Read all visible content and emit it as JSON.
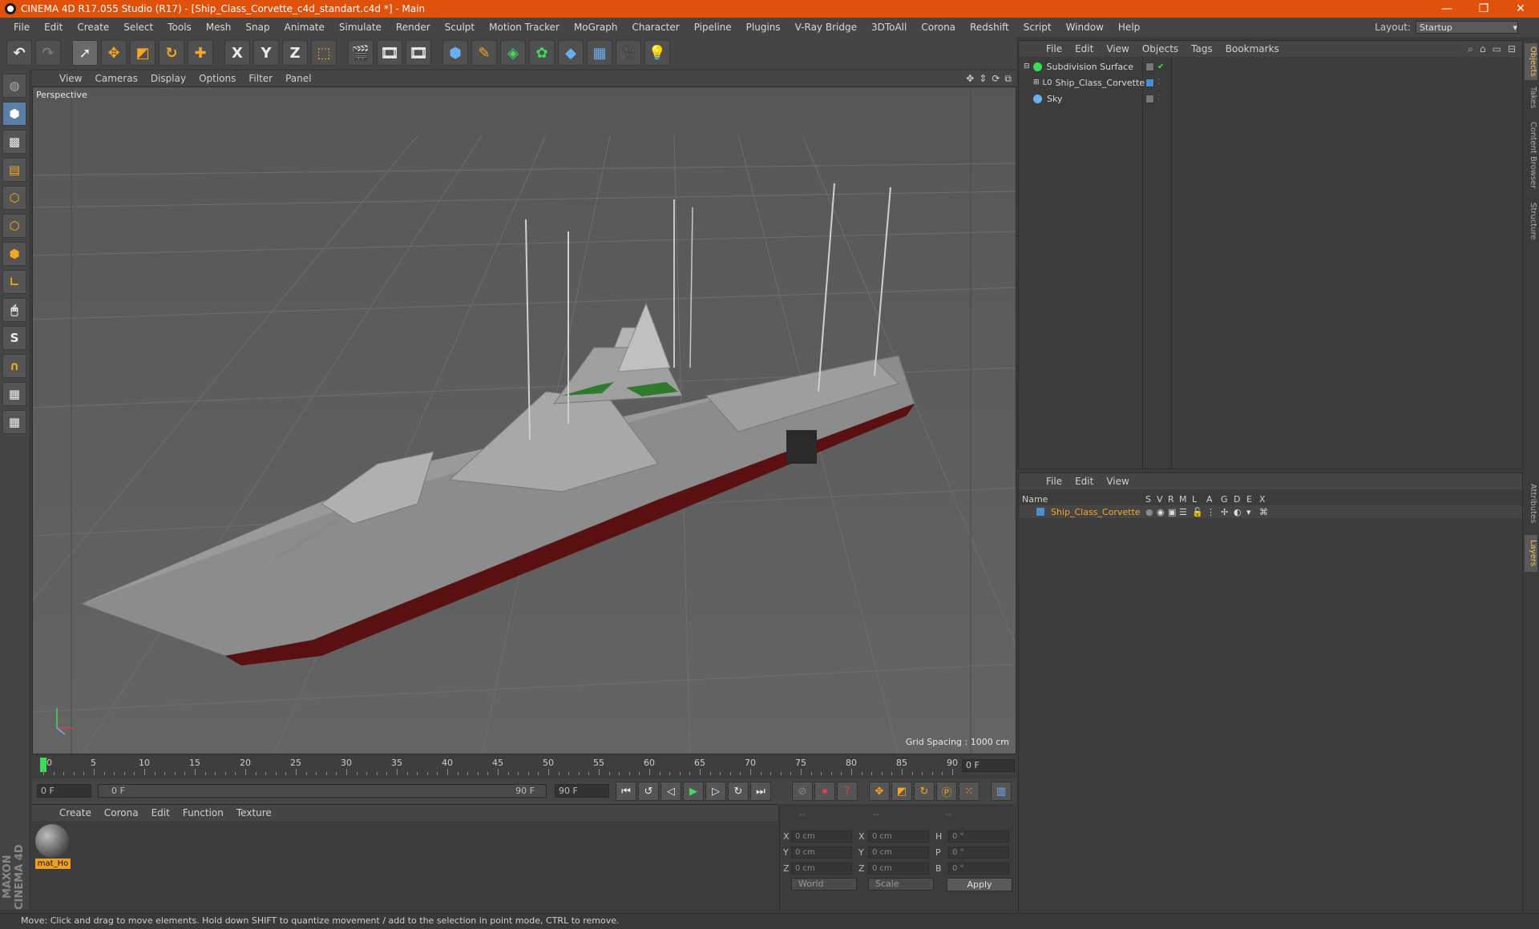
{
  "window": {
    "title": "CINEMA 4D R17.055 Studio (R17) - [Ship_Class_Corvette_c4d_standart.c4d *] - Main",
    "controls": [
      "—",
      "❐",
      "✕"
    ]
  },
  "menubar": {
    "items": [
      "File",
      "Edit",
      "Create",
      "Select",
      "Tools",
      "Mesh",
      "Snap",
      "Animate",
      "Simulate",
      "Render",
      "Sculpt",
      "Motion Tracker",
      "MoGraph",
      "Character",
      "Pipeline",
      "Plugins",
      "V-Ray Bridge",
      "3DToAll",
      "Corona",
      "Redshift",
      "Script",
      "Window",
      "Help"
    ],
    "layout_label": "Layout:",
    "layout_value": "Startup"
  },
  "toolbar": {
    "axis_x": "X",
    "axis_y": "Y",
    "axis_z": "Z"
  },
  "left_tools": {
    "snap_label": "S"
  },
  "maxon_logo": "MAXON CINEMA 4D",
  "viewport": {
    "menu": [
      "View",
      "Cameras",
      "Display",
      "Options",
      "Filter",
      "Panel"
    ],
    "label": "Perspective",
    "grid_spacing": "Grid Spacing : 1000 cm"
  },
  "timeline": {
    "ticks": [
      "0",
      "5",
      "10",
      "15",
      "20",
      "25",
      "30",
      "35",
      "40",
      "45",
      "50",
      "55",
      "60",
      "65",
      "70",
      "75",
      "80",
      "85",
      "90"
    ],
    "current_frame": "0 F"
  },
  "transport": {
    "start_field": "0 F",
    "range_start": "0 F",
    "range_end": "90 F",
    "end_field": "90 F"
  },
  "material_manager": {
    "menu": [
      "Create",
      "Corona",
      "Edit",
      "Function",
      "Texture"
    ],
    "material_name": "mat_Ho"
  },
  "coordinates": {
    "headers": [
      "--",
      "--",
      "--"
    ],
    "rows": [
      {
        "pos_label": "X",
        "pos_value": "0 cm",
        "size_label": "X",
        "size_value": "0 cm",
        "rot_label": "H",
        "rot_value": "0 °"
      },
      {
        "pos_label": "Y",
        "pos_value": "0 cm",
        "size_label": "Y",
        "size_value": "0 cm",
        "rot_label": "P",
        "rot_value": "0 °"
      },
      {
        "pos_label": "Z",
        "pos_value": "0 cm",
        "size_label": "Z",
        "size_value": "0 cm",
        "rot_label": "B",
        "rot_value": "0 °"
      }
    ],
    "coord_system": "World",
    "mode": "Scale",
    "apply": "Apply"
  },
  "object_manager": {
    "menu": [
      "File",
      "Edit",
      "View",
      "Objects",
      "Tags",
      "Bookmarks"
    ],
    "objects": [
      {
        "name": "Subdivision Surface",
        "icon_color": "#3ddc5c"
      },
      {
        "name": "Ship_Class_Corvette",
        "icon_color": "#888888"
      },
      {
        "name": "Sky",
        "icon_color": "#6ab0f0"
      }
    ]
  },
  "layer_manager": {
    "menu": [
      "File",
      "Edit",
      "View"
    ],
    "columns": [
      "Name",
      "S",
      "V",
      "R",
      "M",
      "L",
      "A",
      "G",
      "D",
      "E",
      "X"
    ],
    "layers": [
      {
        "name": "Ship_Class_Corvette",
        "color": "#4a90d0"
      }
    ]
  },
  "right_tabs": [
    "Objects",
    "Takes",
    "Content Browser",
    "Structure",
    "Attributes",
    "Layers"
  ],
  "status": "Move: Click and drag to move elements. Hold down SHIFT to quantize movement / add to the selection in point mode, CTRL to remove.",
  "colors": {
    "titlebar": "#e0520c",
    "accent_orange": "#f5a623",
    "ship_hull": "#8c8c8c",
    "hull_red": "#5a1010"
  }
}
